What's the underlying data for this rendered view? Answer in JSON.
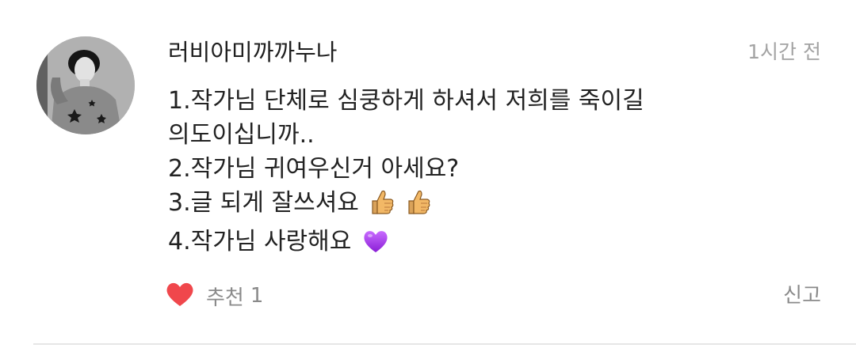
{
  "comment": {
    "username": "러비아미까까누나",
    "timestamp": "1시간 전",
    "lines": [
      {
        "text": "1.작가님 단체로 심쿵하게 하셔서 저희를 죽이길"
      },
      {
        "text": "의도이십니까.."
      },
      {
        "text": "2.작가님 귀여우신거 아세요?"
      },
      {
        "text": "3.글 되게 잘쓰셔요",
        "emojis": [
          "thumbs-up-icon",
          "thumbs-up-icon"
        ]
      },
      {
        "text": "4.작가님 사랑해요",
        "emojis": [
          "purple-heart-icon"
        ]
      }
    ],
    "like": {
      "label": "추천",
      "count": "1",
      "icon": "red-heart-icon",
      "color": "#f0474c"
    },
    "report_label": "신고"
  }
}
